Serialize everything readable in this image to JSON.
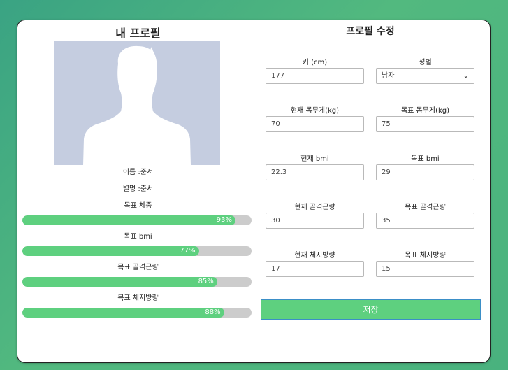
{
  "profile": {
    "title": "내 프로필",
    "name": "이름 :준서",
    "nickname": "별명 :준서",
    "progress": [
      {
        "label": "목표 체중",
        "value": 93,
        "text": "93%"
      },
      {
        "label": "목표 bmi",
        "value": 77,
        "text": "77%"
      },
      {
        "label": "목표 골격근량",
        "value": 85,
        "text": "85%"
      },
      {
        "label": "목표 체지방량",
        "value": 88,
        "text": "88%"
      }
    ]
  },
  "edit": {
    "title": "프로필 수정",
    "height_label": "키 (cm)",
    "height_value": "177",
    "gender_label": "성별",
    "gender_value": "남자",
    "cur_weight_label": "현재 몸무게(kg)",
    "cur_weight_value": "70",
    "goal_weight_label": "목표 몸무게(kg)",
    "goal_weight_value": "75",
    "cur_bmi_label": "현재 bmi",
    "cur_bmi_value": "22.3",
    "goal_bmi_label": "목표 bmi",
    "goal_bmi_value": "29",
    "cur_muscle_label": "현재 골격근량",
    "cur_muscle_value": "30",
    "goal_muscle_label": "목표 골격근량",
    "goal_muscle_value": "35",
    "cur_fat_label": "현재 체지방량",
    "cur_fat_value": "17",
    "goal_fat_label": "목표 체지방량",
    "goal_fat_value": "15",
    "save_label": "저장"
  },
  "colors": {
    "accent": "#5ed07f",
    "bar_track": "#cccccc",
    "avatar_bg": "#c5cde0",
    "avatar_fg": "#ffffff"
  }
}
